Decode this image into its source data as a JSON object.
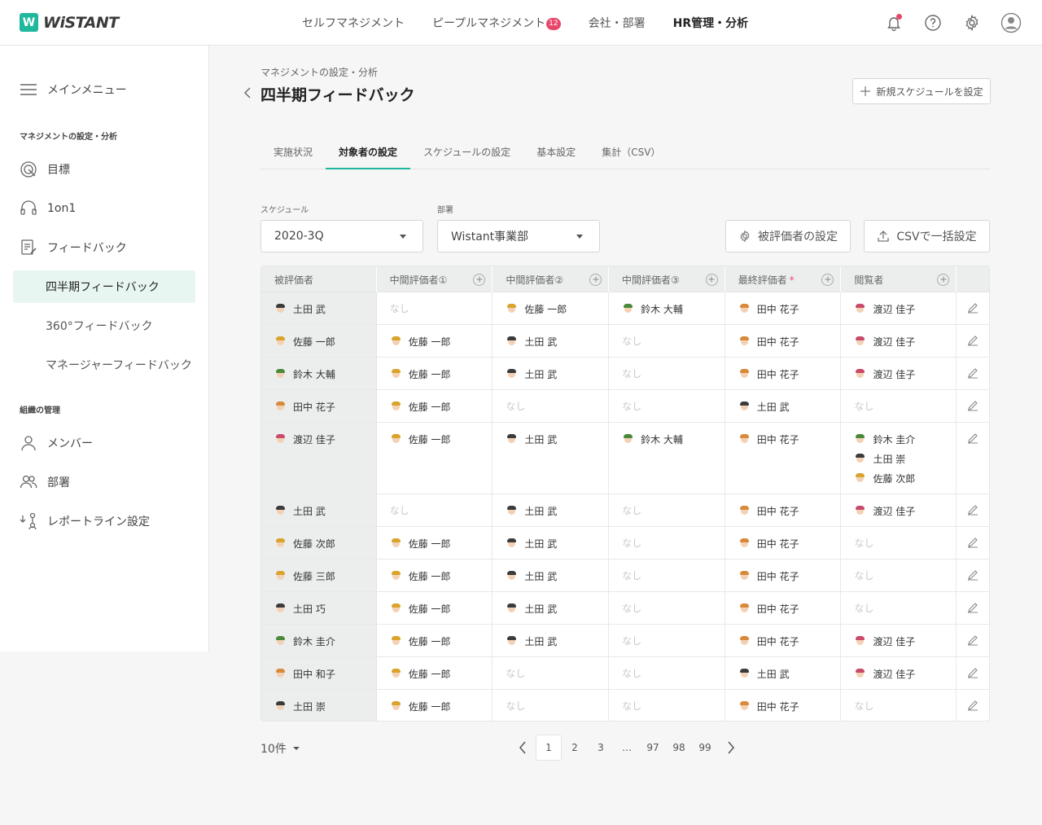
{
  "brand": {
    "logo_mark": "W",
    "name": "WiSTANT",
    "accent": "#1fb89c",
    "badge_color": "#e9476a"
  },
  "topnav": [
    {
      "label": "セルフマネジメント",
      "active": false,
      "badge": null
    },
    {
      "label": "ピープルマネジメント",
      "active": false,
      "badge": "12"
    },
    {
      "label": "会社・部署",
      "active": false,
      "badge": null
    },
    {
      "label": "HR管理・分析",
      "active": true,
      "badge": null
    }
  ],
  "top_icons": [
    "bell-icon",
    "help-icon",
    "gear-icon",
    "user-icon"
  ],
  "sidebar": {
    "main_menu": "メインメニュー",
    "section1": "マネジメントの設定・分析",
    "goal": "目標",
    "oneonone": "1on1",
    "feedback": "フィードバック",
    "sub_quarterly": "四半期フィードバック",
    "sub_360": "360°フィードバック",
    "sub_manager": "マネージャーフィードバック",
    "section2": "組織の管理",
    "members": "メンバー",
    "departments": "部署",
    "reportline": "レポートライン設定"
  },
  "page": {
    "breadcrumb": "マネジメントの設定・分析",
    "title": "四半期フィードバック",
    "new_schedule": "新規スケジュールを設定"
  },
  "tabs": [
    {
      "label": "実施状況",
      "active": false
    },
    {
      "label": "対象者の設定",
      "active": true
    },
    {
      "label": "スケジュールの設定",
      "active": false
    },
    {
      "label": "基本設定",
      "active": false
    },
    {
      "label": "集計（CSV）",
      "active": false
    }
  ],
  "filters": {
    "schedule_label": "スケジュール",
    "schedule_value": "2020-3Q",
    "dept_label": "部署",
    "dept_value": "Wistant事業部",
    "evaluatee_btn": "被評価者の設定",
    "csv_btn": "CSVで一括設定"
  },
  "table": {
    "headers": [
      "被評価者",
      "中間評価者①",
      "中間評価者②",
      "中間評価者③",
      "最終評価者",
      "閲覧者"
    ],
    "none_text": "なし",
    "rows": [
      {
        "evaluatee": "土田 武",
        "mid1": [],
        "mid2": [
          "佐藤 一郎"
        ],
        "mid3": [
          "鈴木 大輔"
        ],
        "final": [
          "田中 花子"
        ],
        "viewers": [
          "渡辺 佳子"
        ]
      },
      {
        "evaluatee": "佐藤 一郎",
        "mid1": [
          "佐藤 一郎"
        ],
        "mid2": [
          "土田 武"
        ],
        "mid3": [],
        "final": [
          "田中 花子"
        ],
        "viewers": [
          "渡辺 佳子"
        ]
      },
      {
        "evaluatee": "鈴木 大輔",
        "mid1": [
          "佐藤 一郎"
        ],
        "mid2": [
          "土田 武"
        ],
        "mid3": [],
        "final": [
          "田中 花子"
        ],
        "viewers": [
          "渡辺 佳子"
        ]
      },
      {
        "evaluatee": "田中 花子",
        "mid1": [
          "佐藤 一郎"
        ],
        "mid2": [],
        "mid3": [],
        "final": [
          "土田 武"
        ],
        "viewers": []
      },
      {
        "evaluatee": "渡辺 佳子",
        "mid1": [
          "佐藤 一郎"
        ],
        "mid2": [
          "土田 武"
        ],
        "mid3": [
          "鈴木 大輔"
        ],
        "final": [
          "田中 花子"
        ],
        "viewers": [
          "鈴木 圭介",
          "土田 崇",
          "佐藤 次郎"
        ]
      },
      {
        "evaluatee": "土田 武",
        "mid1": [],
        "mid2": [
          "土田 武"
        ],
        "mid3": [],
        "final": [
          "田中 花子"
        ],
        "viewers": [
          "渡辺 佳子"
        ]
      },
      {
        "evaluatee": "佐藤 次郎",
        "mid1": [
          "佐藤 一郎"
        ],
        "mid2": [
          "土田 武"
        ],
        "mid3": [],
        "final": [
          "田中 花子"
        ],
        "viewers": []
      },
      {
        "evaluatee": "佐藤 三郎",
        "mid1": [
          "佐藤 一郎"
        ],
        "mid2": [
          "土田 武"
        ],
        "mid3": [],
        "final": [
          "田中 花子"
        ],
        "viewers": []
      },
      {
        "evaluatee": "土田 巧",
        "mid1": [
          "佐藤 一郎"
        ],
        "mid2": [
          "土田 武"
        ],
        "mid3": [],
        "final": [
          "田中 花子"
        ],
        "viewers": []
      },
      {
        "evaluatee": "鈴木 圭介",
        "mid1": [
          "佐藤 一郎"
        ],
        "mid2": [
          "土田 武"
        ],
        "mid3": [],
        "final": [
          "田中 花子"
        ],
        "viewers": [
          "渡辺 佳子"
        ]
      },
      {
        "evaluatee": "田中 和子",
        "mid1": [
          "佐藤 一郎"
        ],
        "mid2": [],
        "mid3": [],
        "final": [
          "土田 武"
        ],
        "viewers": [
          "渡辺 佳子"
        ]
      },
      {
        "evaluatee": "土田 崇",
        "mid1": [
          "佐藤 一郎"
        ],
        "mid2": [],
        "mid3": [],
        "final": [
          "田中 花子"
        ],
        "viewers": []
      }
    ]
  },
  "pagination": {
    "per_page": "10件",
    "pages": [
      "1",
      "2",
      "3",
      "…",
      "97",
      "98",
      "99"
    ],
    "current": "1"
  }
}
